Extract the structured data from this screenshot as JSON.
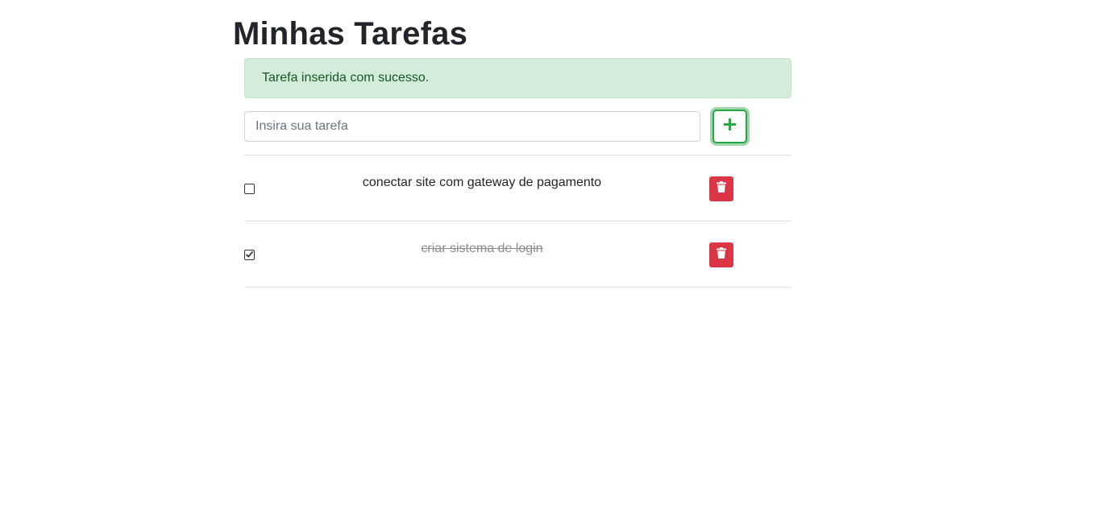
{
  "page": {
    "title": "Minhas Tarefas"
  },
  "alert": {
    "message": "Tarefa inserida com sucesso.",
    "type": "success"
  },
  "form": {
    "input_placeholder": "Insira sua tarefa",
    "input_value": "",
    "add_icon": "plus-icon"
  },
  "tasks": [
    {
      "text": "conectar site com gateway de pagamento",
      "done": false,
      "delete_icon": "trash-icon"
    },
    {
      "text": "criar sistema de login",
      "done": true,
      "delete_icon": "trash-icon"
    }
  ],
  "colors": {
    "success": "#28a745",
    "alert_bg": "#d4edda",
    "alert_text": "#155724",
    "danger": "#dc3545"
  }
}
